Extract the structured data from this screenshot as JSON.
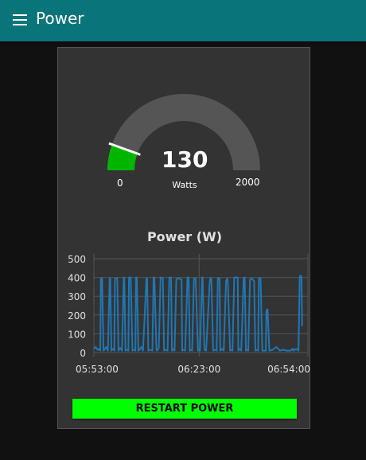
{
  "header": {
    "title": "Power",
    "menu_icon": "hamburger-menu-icon",
    "background_color": "#097479"
  },
  "gauge": {
    "value": 130,
    "value_text": "130",
    "units": "Watts",
    "min": 0,
    "max": 2000,
    "min_label": "0",
    "max_label": "2000",
    "fill_color": "#00b500",
    "track_color": "#555555",
    "needle_color": "#ffffff"
  },
  "chart_data": {
    "type": "line",
    "title": "Power (W)",
    "xlabel": "",
    "ylabel": "",
    "ylim": [
      0,
      500
    ],
    "yticks": [
      0,
      100,
      200,
      300,
      400,
      500
    ],
    "ytick_labels": [
      "0",
      "100",
      "200",
      "300",
      "400",
      "500"
    ],
    "xlim": [
      "05:53:00",
      "06:54:00"
    ],
    "xtick_labels": [
      "05:53:00",
      "06:23:00",
      "06:54:00"
    ],
    "grid": true,
    "legend": "none",
    "series": [
      {
        "color": "#1f77b4",
        "x": [
          "05:53:00",
          "05:53:30",
          "05:54:00",
          "05:54:20",
          "05:54:50",
          "05:55:00",
          "05:55:20",
          "05:55:45",
          "05:56:00",
          "05:56:30",
          "05:57:00",
          "05:57:30",
          "05:57:40",
          "05:58:00",
          "05:58:20",
          "05:58:50",
          "05:59:00",
          "05:59:40",
          "06:00:00",
          "06:00:30",
          "06:01:00",
          "06:01:30",
          "06:01:40",
          "06:02:00",
          "06:02:20",
          "06:02:50",
          "06:03:00",
          "06:03:30",
          "06:04:00",
          "06:04:20",
          "06:04:50",
          "06:05:00",
          "06:05:15",
          "06:05:40",
          "06:06:00",
          "06:06:30",
          "06:07:00",
          "06:08:00",
          "06:08:10",
          "06:08:30",
          "06:09:00",
          "06:09:40",
          "06:10:00",
          "06:10:15",
          "06:10:50",
          "06:11:00",
          "06:11:30",
          "06:12:00",
          "06:12:40",
          "06:13:00",
          "06:13:20",
          "06:14:00",
          "06:14:30",
          "06:15:00",
          "06:15:15",
          "06:15:50",
          "06:16:00",
          "06:16:30",
          "06:17:00",
          "06:18:00",
          "06:18:10",
          "06:18:30",
          "06:19:00",
          "06:19:40",
          "06:20:00",
          "06:20:20",
          "06:20:50",
          "06:21:00",
          "06:21:30",
          "06:22:00",
          "06:22:40",
          "06:23:00",
          "06:23:15",
          "06:23:50",
          "06:24:00",
          "06:24:30",
          "06:25:00",
          "06:26:00",
          "06:26:10",
          "06:26:30",
          "06:27:00",
          "06:27:40",
          "06:28:00",
          "06:28:20",
          "06:28:50",
          "06:29:00",
          "06:29:30",
          "06:30:00",
          "06:30:40",
          "06:31:00",
          "06:31:10",
          "06:31:50",
          "06:32:00",
          "06:32:30",
          "06:33:00",
          "06:34:00",
          "06:34:10",
          "06:34:30",
          "06:35:00",
          "06:35:40",
          "06:36:00",
          "06:36:20",
          "06:36:50",
          "06:37:00",
          "06:37:30",
          "06:38:00",
          "06:38:40",
          "06:39:00",
          "06:39:15",
          "06:39:50",
          "06:40:00",
          "06:40:30",
          "06:41:00",
          "06:42:00",
          "06:42:10",
          "06:42:30",
          "06:43:00",
          "06:44:00",
          "06:45:00",
          "06:46:00",
          "06:47:00",
          "06:48:00",
          "06:49:00",
          "06:49:40",
          "06:49:50",
          "06:50:00",
          "06:50:20",
          "06:50:40",
          "06:51:00",
          "06:51:20",
          "06:51:40",
          "06:52:00",
          "06:52:10",
          "06:52:20"
        ],
        "y": [
          20,
          30,
          15,
          20,
          10,
          395,
          395,
          10,
          15,
          30,
          10,
          395,
          395,
          10,
          20,
          10,
          395,
          395,
          10,
          25,
          10,
          400,
          400,
          10,
          15,
          10,
          400,
          400,
          10,
          15,
          10,
          400,
          400,
          10,
          15,
          30,
          10,
          395,
          395,
          10,
          15,
          10,
          400,
          400,
          15,
          10,
          25,
          400,
          395,
          10,
          15,
          10,
          400,
          400,
          10,
          20,
          10,
          390,
          395,
          390,
          10,
          15,
          10,
          400,
          400,
          10,
          15,
          10,
          395,
          395,
          10,
          20,
          10,
          400,
          400,
          15,
          10,
          370,
          395,
          395,
          10,
          15,
          10,
          395,
          395,
          10,
          20,
          10,
          380,
          395,
          380,
          10,
          15,
          10,
          400,
          400,
          10,
          20,
          10,
          395,
          400,
          10,
          15,
          10,
          390,
          395,
          380,
          10,
          15,
          10,
          395,
          395,
          10,
          10,
          225,
          230,
          10,
          15,
          30,
          10,
          15,
          10,
          10,
          20,
          10,
          15,
          15,
          20,
          15,
          10,
          405,
          410,
          400,
          140
        ]
      }
    ]
  },
  "actions": {
    "restart_label": "RESTART POWER",
    "button_color": "#00ff00"
  }
}
